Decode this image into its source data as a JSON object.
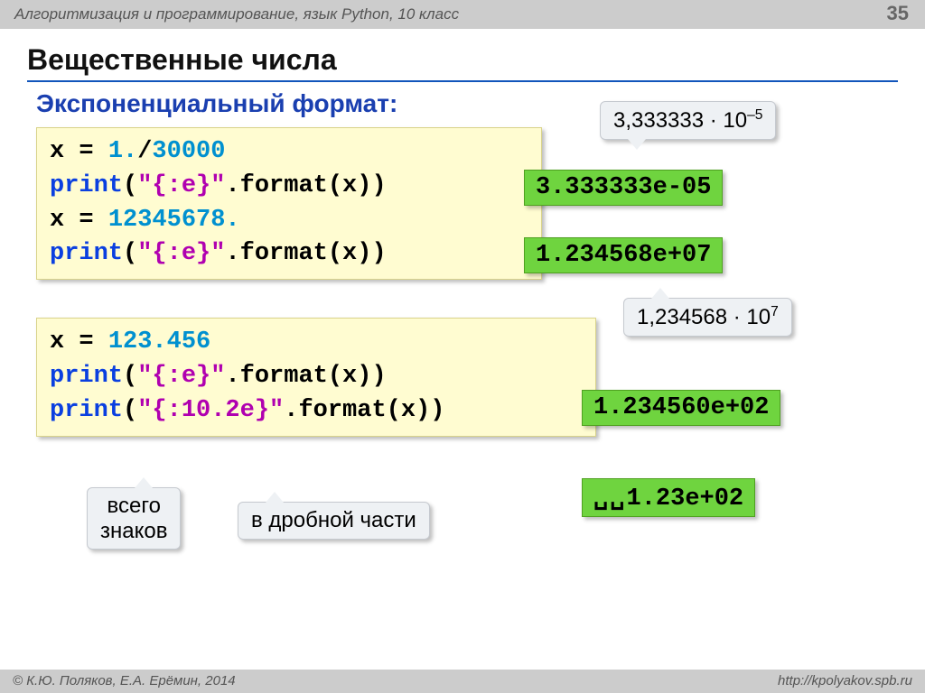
{
  "page": {
    "header_text": "Алгоритмизация и программирование, язык Python, 10 класс",
    "page_number": "35",
    "footer_left": "© К.Ю. Поляков, Е.А. Ерёмин, 2014",
    "footer_right": "http://kpolyakov.spb.ru"
  },
  "title": "Вещественные числа",
  "subtitle": "Экспоненциальный формат:",
  "code1": {
    "line1_a": "x",
    "line1_eq": " = ",
    "line1_b": "1.",
    "line1_c": "/",
    "line1_d": "30000",
    "line2_a": "print",
    "line2_b": "(",
    "line2_c": "\"{:e}\"",
    "line2_d": ".format(x))",
    "line3_a": "x",
    "line3_eq": " = ",
    "line3_b": "12345678.",
    "line4_a": "print",
    "line4_b": "(",
    "line4_c": "\"{:e}\"",
    "line4_d": ".format(x))"
  },
  "code2": {
    "line1_a": "x",
    "line1_eq": " = ",
    "line1_b": "123.456",
    "line2_a": "print",
    "line2_b": "(",
    "line2_c": "\"{:e}\"",
    "line2_d": ".format(x))",
    "line3_a": "print",
    "line3_b": "(",
    "line3_c": "\"{:10.2e}\"",
    "line3_d": ".format(x))"
  },
  "outputs": {
    "o1": "3.333333e-05",
    "o2": "1.234568e+07",
    "o3": "1.234560e+02",
    "o4_spaces": "␣␣",
    "o4_rest": "1.23e+02"
  },
  "callouts": {
    "c1_main": "3,333333 · 10",
    "c1_sup": "–5",
    "c2_main": "1,234568 · 10",
    "c2_sup": "7",
    "c3": "всего\nзнаков",
    "c4": "в дробной части"
  }
}
